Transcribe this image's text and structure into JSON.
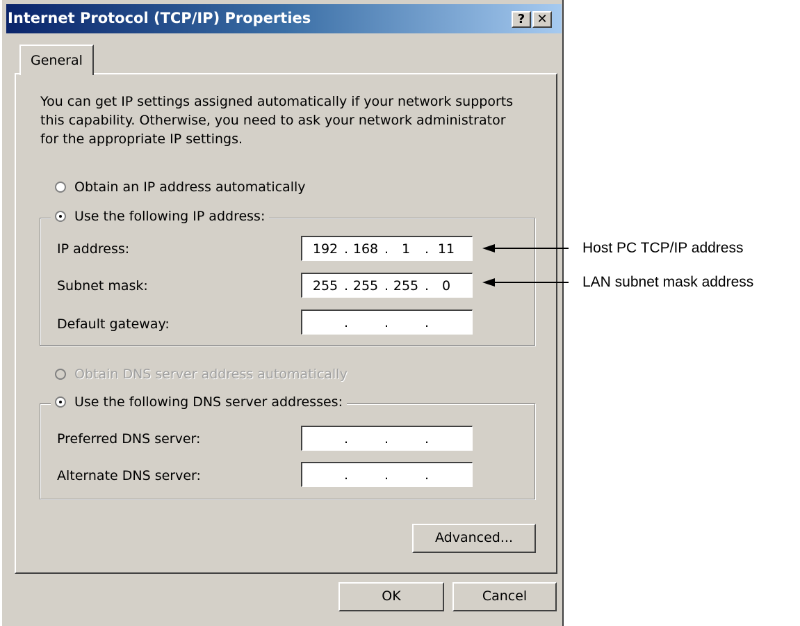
{
  "window": {
    "title": "Internet Protocol (TCP/IP) Properties",
    "help_label": "?",
    "close_label": "✕"
  },
  "tabs": [
    {
      "label": "General"
    }
  ],
  "intro_text": "You can get IP settings assigned automatically if your network supports this capability. Otherwise, you need to ask your network administrator for the appropriate IP settings.",
  "ip_mode": {
    "auto_label": "Obtain an IP address automatically",
    "manual_label": "Use the following IP address:",
    "selected": "manual"
  },
  "ip_fields": {
    "ip_address": {
      "label": "IP address:",
      "octets": [
        "192",
        "168",
        "1",
        "11"
      ]
    },
    "subnet_mask": {
      "label": "Subnet mask:",
      "octets": [
        "255",
        "255",
        "255",
        "0"
      ]
    },
    "default_gateway": {
      "label": "Default gateway:",
      "octets": [
        "",
        "",
        "",
        ""
      ]
    }
  },
  "dns_mode": {
    "auto_label": "Obtain DNS server address automatically",
    "manual_label": "Use the following DNS server addresses:",
    "selected": "manual",
    "auto_disabled": true
  },
  "dns_fields": {
    "preferred": {
      "label": "Preferred DNS server:",
      "octets": [
        "",
        "",
        "",
        ""
      ]
    },
    "alternate": {
      "label": "Alternate DNS server:",
      "octets": [
        "",
        "",
        "",
        ""
      ]
    }
  },
  "buttons": {
    "advanced": "Advanced...",
    "ok": "OK",
    "cancel": "Cancel"
  },
  "annotations": {
    "host_ip": "Host PC TCP/IP address",
    "subnet": "LAN subnet mask address"
  }
}
